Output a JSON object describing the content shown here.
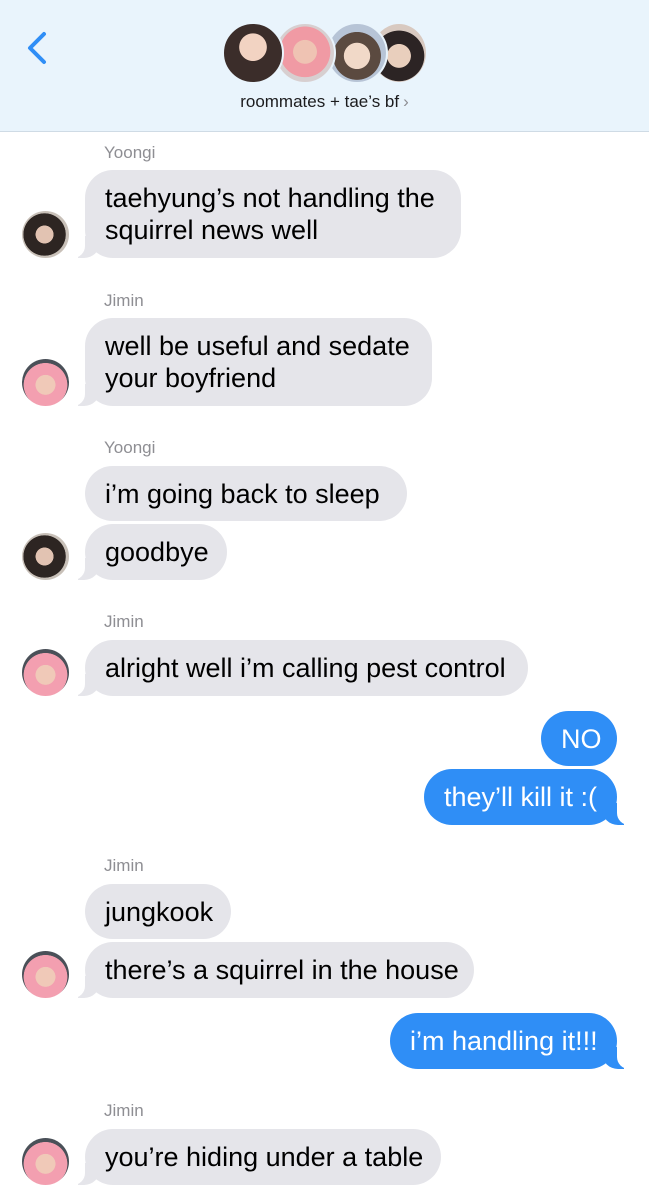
{
  "header": {
    "back_icon": "chevron-left-icon",
    "group_name": "roommates + tae’s bf",
    "chevron": "›",
    "accent_color": "#2f8ef6"
  },
  "messages": [
    {
      "sender": "Yoongi",
      "lines": [
        "taehyung’s not handling the",
        "squirrel news well"
      ]
    },
    {
      "sender": "Jimin",
      "lines": [
        "well be useful and sedate",
        "your boyfriend"
      ]
    },
    {
      "sender": "Yoongi",
      "text": "i’m going back to sleep"
    },
    {
      "text": "goodbye"
    },
    {
      "sender": "Jimin",
      "text": "alright well i’m calling pest control"
    },
    {
      "outgoing": true,
      "text": "NO"
    },
    {
      "outgoing": true,
      "text": "they’ll kill it :("
    },
    {
      "sender": "Jimin",
      "text": "jungkook"
    },
    {
      "text": "there’s a squirrel in the house"
    },
    {
      "outgoing": true,
      "text": "i’m handling it!!!"
    },
    {
      "sender": "Jimin",
      "text": "you’re hiding under a table"
    }
  ]
}
